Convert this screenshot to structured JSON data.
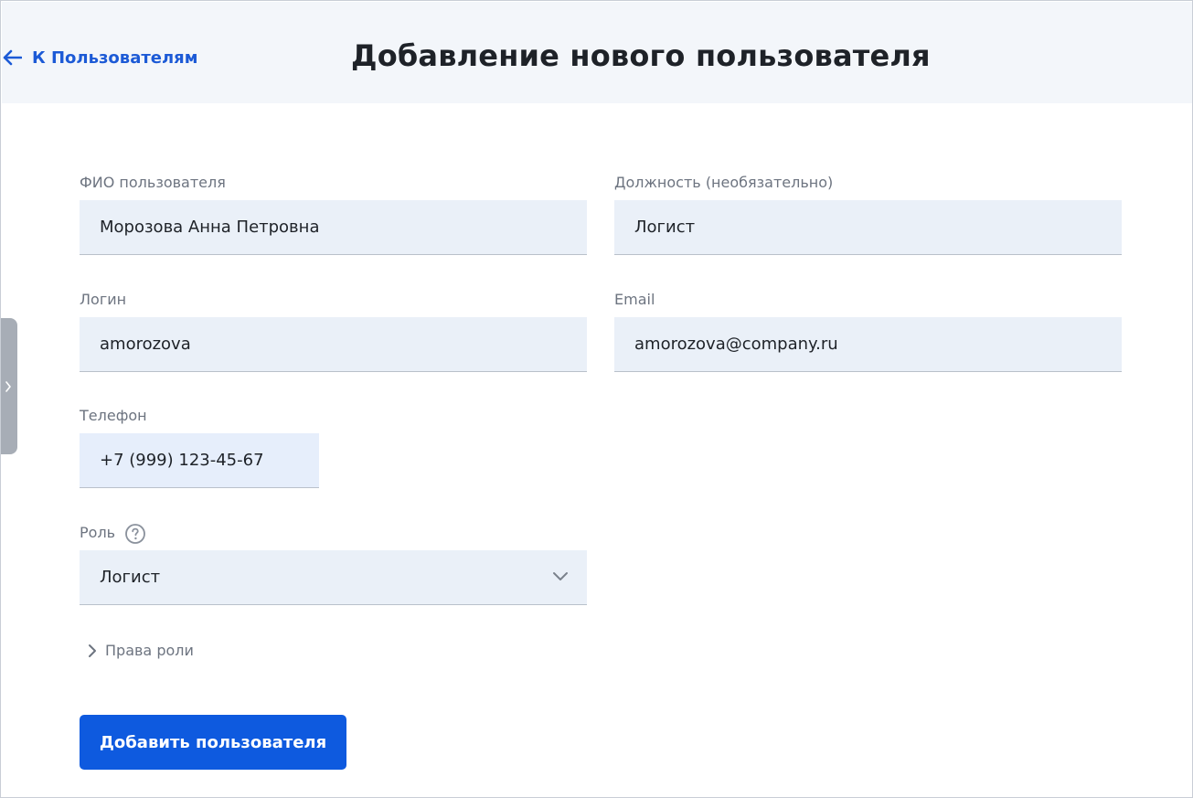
{
  "header": {
    "back_label": "К Пользователям",
    "title": "Добавление нового пользователя"
  },
  "form": {
    "fio": {
      "label": "ФИО пользователя",
      "value": "Морозова Анна Петровна"
    },
    "position": {
      "label": "Должность (необязательно)",
      "value": "Логист"
    },
    "login": {
      "label": "Логин",
      "value": "amorozova"
    },
    "email": {
      "label": "Email",
      "value": "amorozova@company.ru"
    },
    "phone": {
      "label": "Телефон",
      "value": "+7 (999) 123-45-67"
    },
    "role": {
      "label": "Роль",
      "value": "Логист"
    },
    "role_rights_label": "Права роли",
    "submit_label": "Добавить пользователя"
  },
  "colors": {
    "accent": "#0e5adf",
    "link": "#1c5ad6",
    "field_bg": "#eaf0f8",
    "header_bg": "#f3f6fa"
  },
  "icons": {
    "back": "arrow-left-icon",
    "help": "question-circle-icon",
    "dropdown": "chevron-down-icon",
    "expand": "chevron-right-icon",
    "side_panel": "chevron-right-icon"
  }
}
